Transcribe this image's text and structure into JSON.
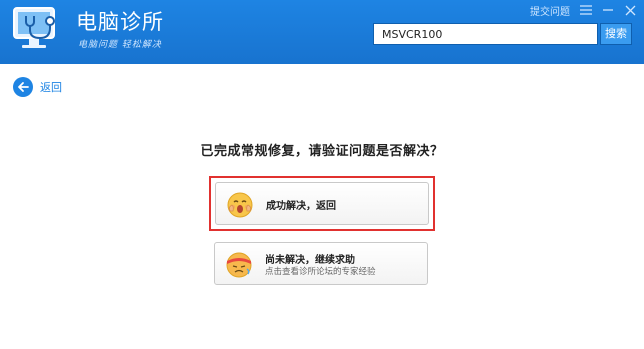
{
  "app": {
    "title": "电脑诊所",
    "slogan": "电脑问题 轻松解决"
  },
  "top_bar": {
    "feedback_label": "提交问题",
    "menu_icon": "menu-icon",
    "minimize_icon": "minimize-icon",
    "close_icon": "close-icon"
  },
  "search": {
    "value": "MSVCR100",
    "button_label": "搜索"
  },
  "nav": {
    "back_label": "返回",
    "back_icon": "back-arrow-icon"
  },
  "main": {
    "question": "已完成常规修复，请验证问题是否解决？",
    "options": [
      {
        "title": "成功解决，返回",
        "icon": "happy-face-icon"
      },
      {
        "title": "尚未解决，继续求助",
        "subtitle": "点击查看诊所论坛的专家经验",
        "icon": "sick-face-icon"
      }
    ]
  },
  "colors": {
    "header": "#1e84e3",
    "highlight": "#e1312f"
  }
}
